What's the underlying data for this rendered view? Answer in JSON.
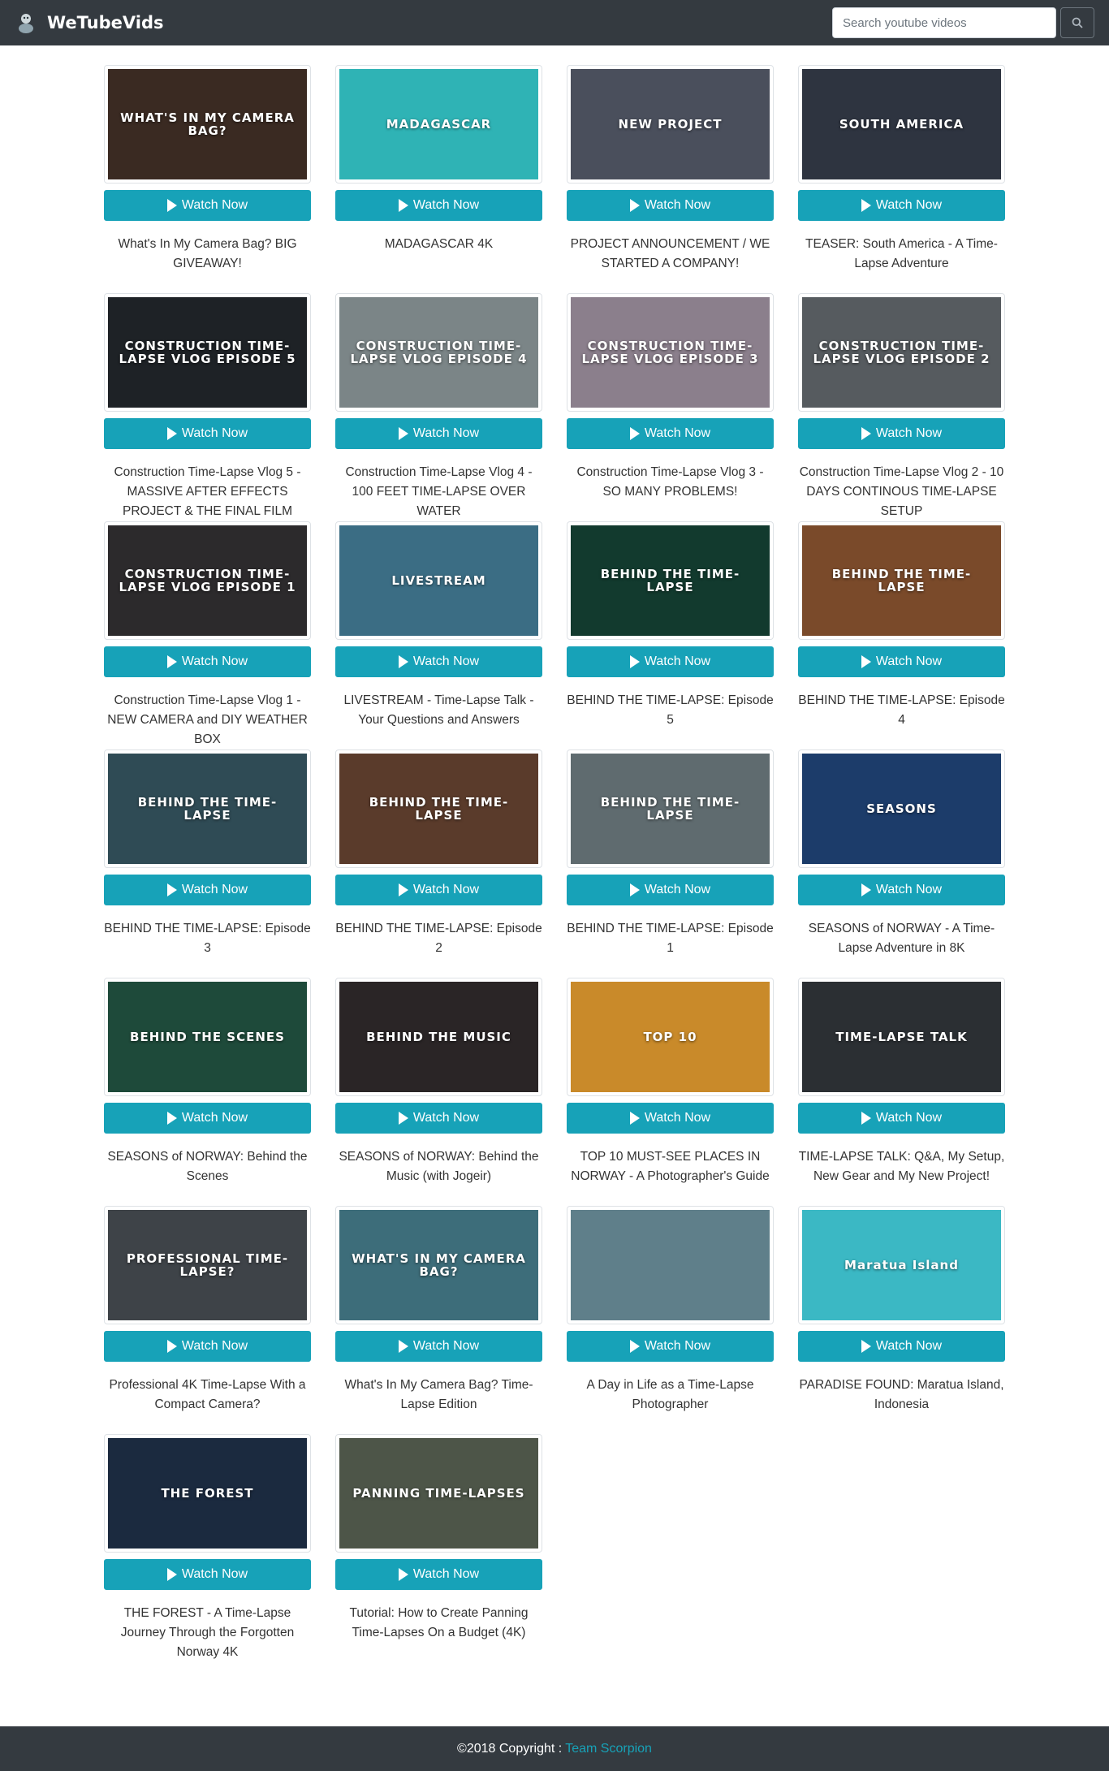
{
  "header": {
    "brand": "WeTubeVids",
    "search_placeholder": "Search youtube videos"
  },
  "button_label": "Watch Now",
  "videos": [
    {
      "title": "What's In My Camera Bag? BIG GIVEAWAY!",
      "thumb_text": "WHAT'S IN MY CAMERA BAG?",
      "bg": "#3a2a22"
    },
    {
      "title": "MADAGASCAR 4K",
      "thumb_text": "MADAGASCAR",
      "bg": "#2fb3b5"
    },
    {
      "title": "PROJECT ANNOUNCEMENT / WE STARTED A COMPANY!",
      "thumb_text": "NEW PROJECT",
      "bg": "#4a4f5c"
    },
    {
      "title": "TEASER: South America - A Time-Lapse Adventure",
      "thumb_text": "SOUTH AMERICA",
      "bg": "#2e3440"
    },
    {
      "title": "Construction Time-Lapse Vlog 5 - MASSIVE AFTER EFFECTS PROJECT & THE FINAL FILM",
      "thumb_text": "CONSTRUCTION TIME-LAPSE VLOG EPISODE 5",
      "bg": "#1e2226"
    },
    {
      "title": "Construction Time-Lapse Vlog 4 - 100 FEET TIME-LAPSE OVER WATER",
      "thumb_text": "CONSTRUCTION TIME-LAPSE VLOG EPISODE 4",
      "bg": "#7b8587"
    },
    {
      "title": "Construction Time-Lapse Vlog 3 - SO MANY PROBLEMS!",
      "thumb_text": "CONSTRUCTION TIME-LAPSE VLOG EPISODE 3",
      "bg": "#8b7f8c"
    },
    {
      "title": "Construction Time-Lapse Vlog 2 - 10 DAYS CONTINOUS TIME-LAPSE SETUP",
      "thumb_text": "CONSTRUCTION TIME-LAPSE VLOG EPISODE 2",
      "bg": "#565b5f"
    },
    {
      "title": "Construction Time-Lapse Vlog 1 - NEW CAMERA and DIY WEATHER BOX",
      "thumb_text": "CONSTRUCTION TIME-LAPSE VLOG EPISODE 1",
      "bg": "#2c2a2c"
    },
    {
      "title": "LIVESTREAM - Time-Lapse Talk - Your Questions and Answers",
      "thumb_text": "LIVESTREAM",
      "bg": "#3b6d84"
    },
    {
      "title": "BEHIND THE TIME-LAPSE: Episode 5",
      "thumb_text": "BEHIND THE TIME-LAPSE",
      "bg": "#123a2e"
    },
    {
      "title": "BEHIND THE TIME-LAPSE: Episode 4",
      "thumb_text": "BEHIND THE TIME-LAPSE",
      "bg": "#7a4a2a"
    },
    {
      "title": "BEHIND THE TIME-LAPSE: Episode 3",
      "thumb_text": "BEHIND THE TIME-LAPSE",
      "bg": "#2f4b55"
    },
    {
      "title": "BEHIND THE TIME-LAPSE: Episode 2",
      "thumb_text": "BEHIND THE TIME-LAPSE",
      "bg": "#5a3b2b"
    },
    {
      "title": "BEHIND THE TIME-LAPSE: Episode 1",
      "thumb_text": "BEHIND THE TIME-LAPSE",
      "bg": "#5f6b6f"
    },
    {
      "title": "SEASONS of NORWAY - A Time-Lapse Adventure in 8K",
      "thumb_text": "SEASONS",
      "bg": "#1c3c6a"
    },
    {
      "title": "SEASONS of NORWAY: Behind the Scenes",
      "thumb_text": "BEHIND THE SCENES",
      "bg": "#1e4a3a"
    },
    {
      "title": "SEASONS of NORWAY: Behind the Music (with Jogeir)",
      "thumb_text": "BEHIND THE MUSIC",
      "bg": "#2a2526"
    },
    {
      "title": "TOP 10 MUST-SEE PLACES IN NORWAY - A Photographer's Guide",
      "thumb_text": "TOP 10",
      "bg": "#c98a2a"
    },
    {
      "title": "TIME-LAPSE TALK: Q&A, My Setup, New Gear and My New Project!",
      "thumb_text": "TIME-LAPSE TALK",
      "bg": "#2b2f33"
    },
    {
      "title": "Professional 4K Time-Lapse With a Compact Camera?",
      "thumb_text": "PROFESSIONAL TIME-LAPSE?",
      "bg": "#3e4348"
    },
    {
      "title": "What's In My Camera Bag? Time-Lapse Edition",
      "thumb_text": "WHAT'S IN MY CAMERA BAG?",
      "bg": "#3d6d7a"
    },
    {
      "title": "A Day in Life as a Time-Lapse Photographer",
      "thumb_text": "",
      "bg": "#5f7f8a"
    },
    {
      "title": "PARADISE FOUND: Maratua Island, Indonesia",
      "thumb_text": "Maratua Island",
      "bg": "#3bb8c4"
    },
    {
      "title": "THE FOREST - A Time-Lapse Journey Through the Forgotten Norway 4K",
      "thumb_text": "THE FOREST",
      "bg": "#1b2a3f"
    },
    {
      "title": "Tutorial: How to Create Panning Time-Lapses On a Budget (4K)",
      "thumb_text": "PANNING TIME-LAPSES",
      "bg": "#4d5548"
    }
  ],
  "footer": {
    "copyright": "©2018 Copyright :",
    "link_text": "Team Scorpion"
  }
}
